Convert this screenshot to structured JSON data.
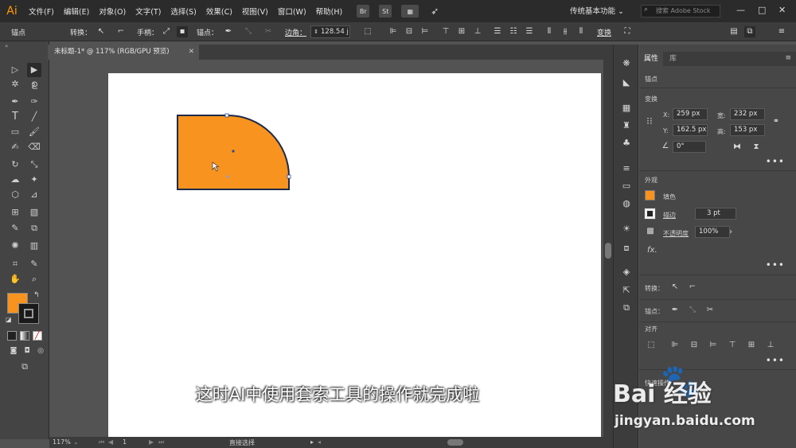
{
  "app": {
    "logo": "Ai"
  },
  "menu": {
    "items": [
      "文件(F)",
      "编辑(E)",
      "对象(O)",
      "文字(T)",
      "选择(S)",
      "效果(C)",
      "视图(V)",
      "窗口(W)",
      "帮助(H)"
    ]
  },
  "app_switcher": {
    "br": "Br",
    "st": "St"
  },
  "workspace": {
    "label": "传统基本功能",
    "caret": "⌄"
  },
  "stock_search": {
    "placeholder": "搜索 Adobe Stock"
  },
  "window_controls": {
    "minimize": "—",
    "maximize": "□",
    "close": "✕"
  },
  "control_bar": {
    "anchor_label": "锚点",
    "convert_label": "转换：",
    "handles_label": "手柄：",
    "anchors_label": "锚点：",
    "corner_label": "边角：",
    "corner_value": "128.54 j",
    "transform_label": "变换"
  },
  "document_tab": {
    "title": "未标题-1* @ 117% (RGB/GPU 预览)",
    "close": "✕"
  },
  "canvas": {
    "subtitle": "这时AI中使用套索工具的操作就完成啦",
    "shape_fill": "#f7931e",
    "shape_stroke": "#1d2a4a"
  },
  "status_bar": {
    "zoom": "117%",
    "artboard_num": "1",
    "tool_name": "直接选择"
  },
  "colors": {
    "fill": "#f7931e",
    "stroke": "#1a1a1a"
  },
  "panel": {
    "tabs": [
      "属性",
      "库"
    ],
    "selection_type": "锚点",
    "transform_title": "变换",
    "x_label": "X:",
    "x_value": "259 px",
    "y_label": "Y:",
    "y_value": "162.5 px",
    "w_label": "宽:",
    "w_value": "232 px",
    "h_label": "高:",
    "h_value": "153 px",
    "angle_value": "0°",
    "appearance_title": "外观",
    "fill_label": "填色",
    "stroke_label": "描边",
    "stroke_value": "3 pt",
    "opacity_label": "不透明度",
    "opacity_value": "100%",
    "fx_label": "fx.",
    "convert_label": "转换：",
    "anchor_label": "锚点：",
    "align_title": "对齐",
    "quick_actions_title": "快速操作",
    "more": "•••"
  },
  "watermark": {
    "brand": "Bai  经验",
    "url": "jingyan.baidu.com",
    "paw": "🐾"
  }
}
